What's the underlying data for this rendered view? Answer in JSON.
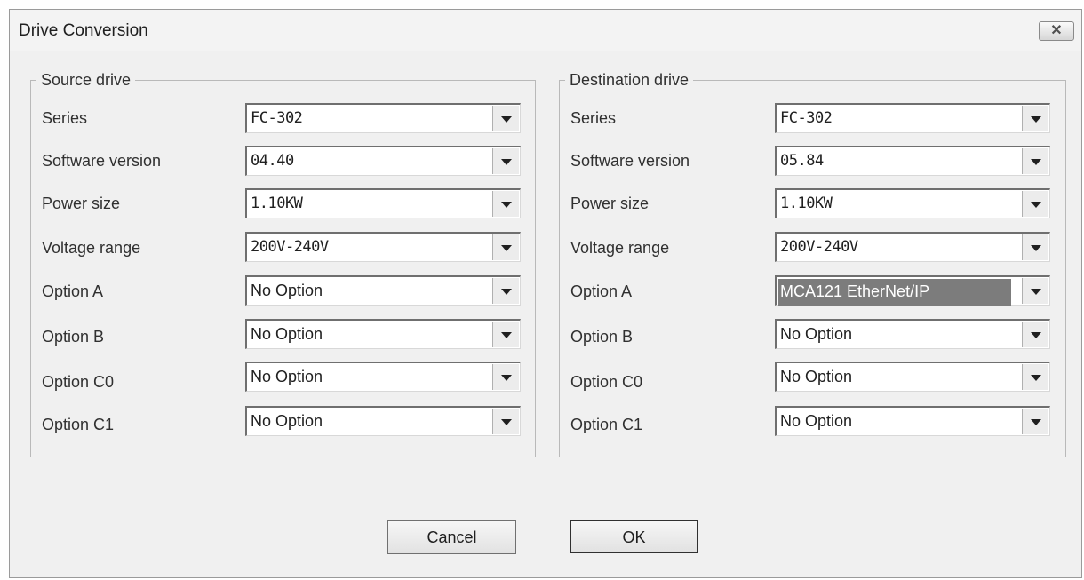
{
  "window": {
    "title": "Drive Conversion",
    "close_icon": "close-icon"
  },
  "source": {
    "title": "Source drive",
    "rows": [
      {
        "label": "Series",
        "value": "FC-302"
      },
      {
        "label": "Software version",
        "value": "04.40"
      },
      {
        "label": "Power size",
        "value": "1.10KW"
      },
      {
        "label": "Voltage range",
        "value": "200V-240V"
      },
      {
        "label": "Option A",
        "value": "No Option"
      },
      {
        "label": "Option B",
        "value": "No Option"
      },
      {
        "label": "Option C0",
        "value": "No Option"
      },
      {
        "label": "Option C1",
        "value": "No Option"
      }
    ]
  },
  "destination": {
    "title": "Destination drive",
    "rows": [
      {
        "label": "Series",
        "value": "FC-302"
      },
      {
        "label": "Software version",
        "value": "05.84"
      },
      {
        "label": "Power size",
        "value": "1.10KW"
      },
      {
        "label": "Voltage range",
        "value": "200V-240V"
      },
      {
        "label": "Option A",
        "value": "MCA121 EtherNet/IP"
      },
      {
        "label": "Option B",
        "value": "No Option"
      },
      {
        "label": "Option C0",
        "value": "No Option"
      },
      {
        "label": "Option C1",
        "value": "No Option"
      }
    ]
  },
  "buttons": {
    "cancel": "Cancel",
    "ok": "OK"
  }
}
